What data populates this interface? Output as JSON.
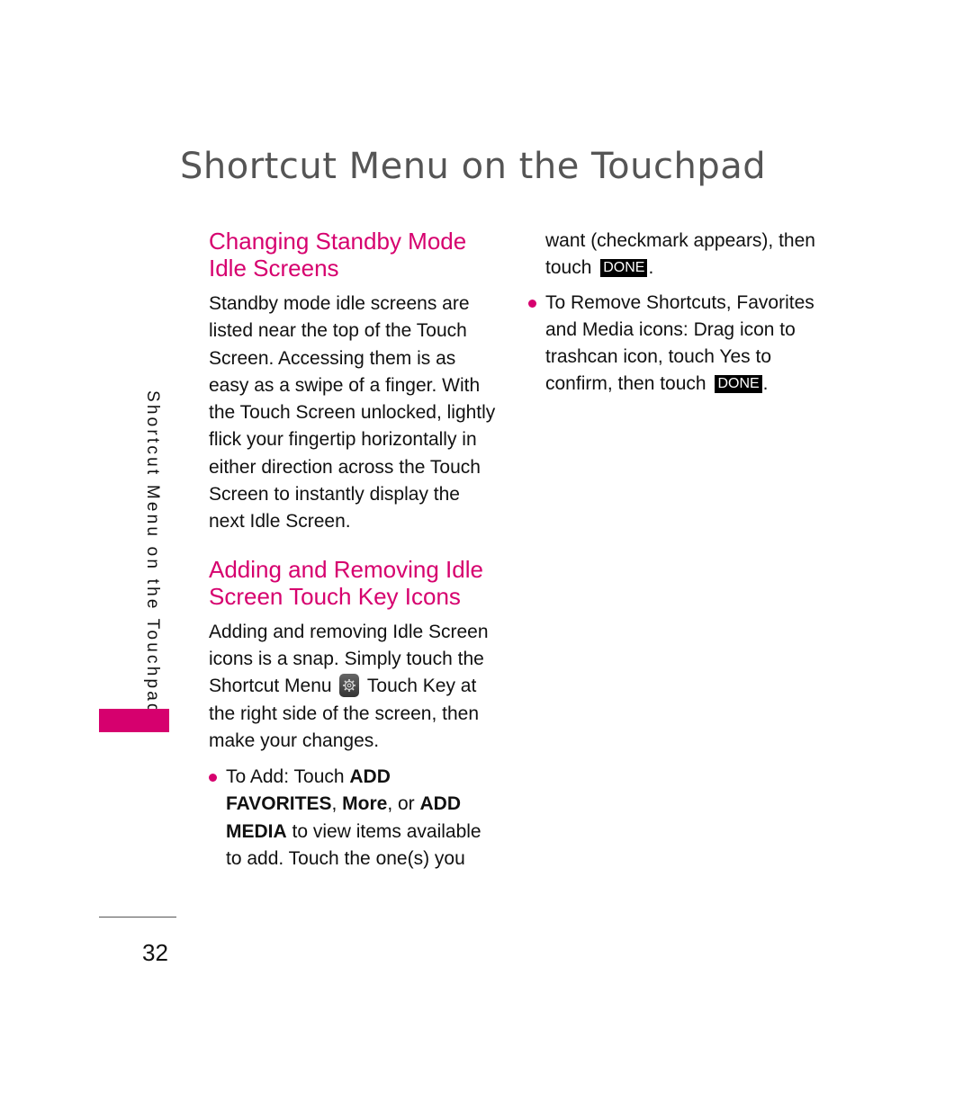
{
  "page": {
    "title": "Shortcut Menu on the Touchpad",
    "side_label": "Shortcut Menu on the Touchpad",
    "page_number": "32",
    "accent_color": "#d6006e"
  },
  "left_column": {
    "section1": {
      "heading_line1": "Changing Standby Mode",
      "heading_line2": "Idle Screens",
      "body": "Standby mode idle screens are listed near the top of the Touch Screen. Accessing them is as easy as a swipe of a finger. With the Touch Screen unlocked, lightly flick your fingertip horizontally in either direction across the Touch Screen to instantly display the next Idle Screen."
    },
    "section2": {
      "heading_line1": "Adding and Removing Idle",
      "heading_line2": "Screen Touch Key Icons",
      "body_before_icon": "Adding and removing Idle Screen icons is a snap. Simply touch the Shortcut Menu",
      "icon": "gear-icon",
      "body_after_icon": "Touch Key at the right side of the screen, then make your changes.",
      "bullet_add": {
        "prefix": "To Add: Touch ",
        "key1": "ADD FAVORITES",
        "sep1": ", ",
        "key2": "More",
        "sep2": ", or ",
        "key3": "ADD MEDIA",
        "suffix": " to view items available to add. Touch the one(s) you"
      }
    }
  },
  "right_column": {
    "continuation": "want (checkmark appears), then touch",
    "done_label": "DONE",
    "period": ".",
    "bullet_remove": {
      "text": "To Remove Shortcuts, Favorites and Media icons: Drag icon to trashcan icon, touch Yes to confirm, then touch",
      "done_label": "DONE",
      "period": "."
    }
  }
}
